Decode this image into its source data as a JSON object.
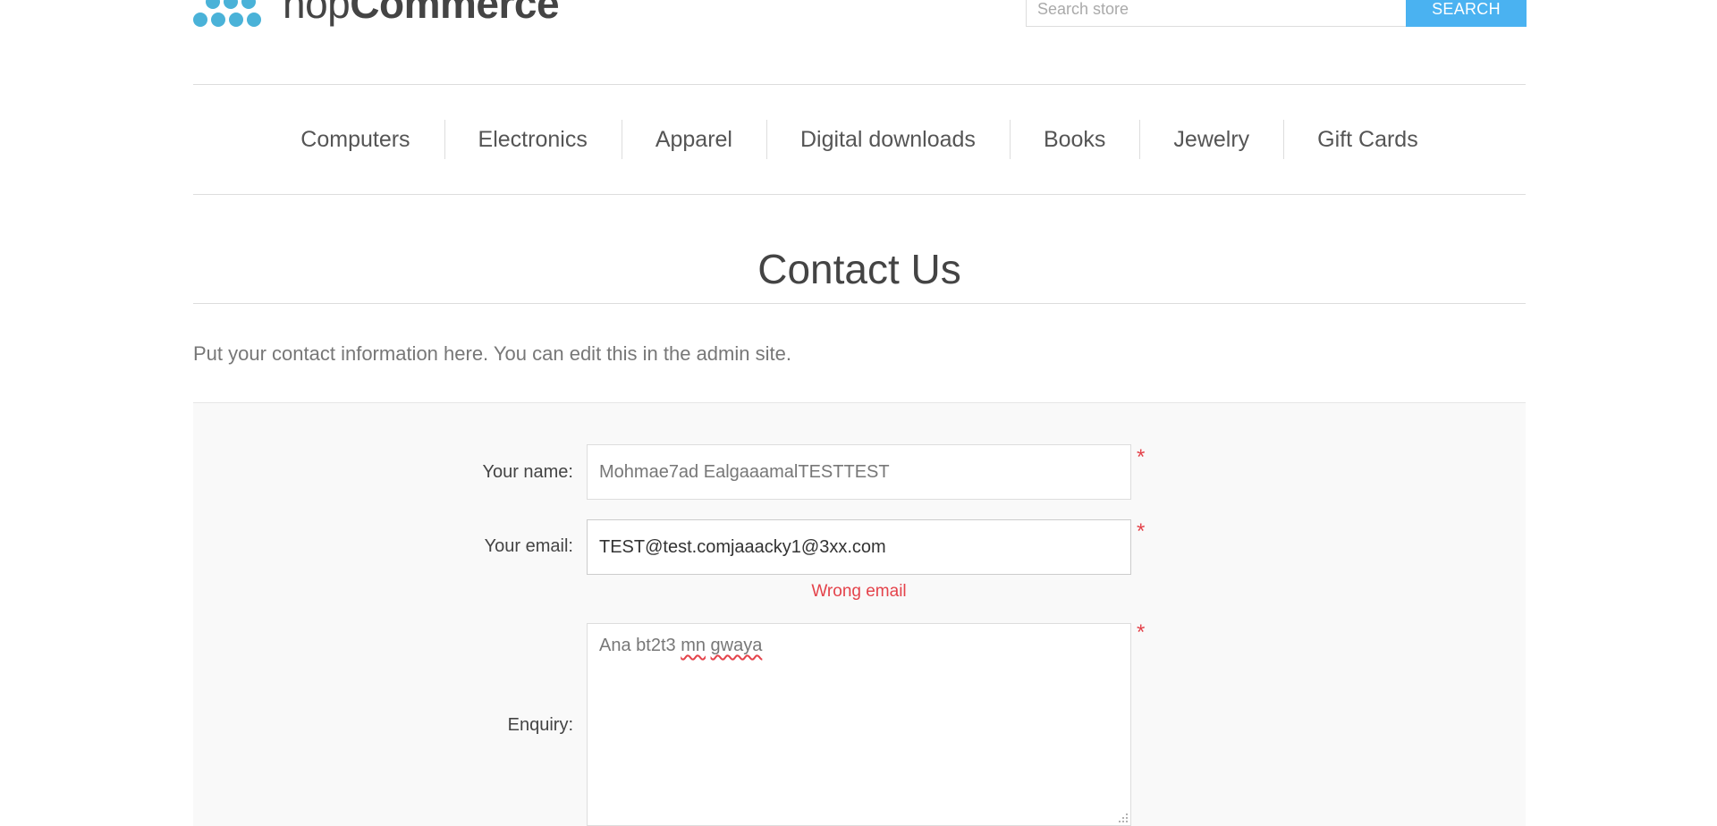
{
  "header": {
    "logo": {
      "light": "nop",
      "bold": "Commerce"
    },
    "search": {
      "placeholder": "Search store",
      "button_label": "SEARCH"
    },
    "colors": {
      "logo_dots": "#4ab2d8",
      "search_button": "#4ab2f1"
    }
  },
  "nav": {
    "items": [
      {
        "label": "Computers"
      },
      {
        "label": "Electronics"
      },
      {
        "label": "Apparel"
      },
      {
        "label": "Digital downloads"
      },
      {
        "label": "Books"
      },
      {
        "label": "Jewelry"
      },
      {
        "label": "Gift Cards"
      }
    ]
  },
  "page": {
    "title": "Contact Us",
    "topic_text": "Put your contact information here. You can edit this in the admin site."
  },
  "form": {
    "name": {
      "label": "Your name:",
      "value": "Mohmae7ad EalgaaamalTESTTEST",
      "required_mark": "*"
    },
    "email": {
      "label": "Your email:",
      "value": "TEST@test.comjaaacky1@3xx.com",
      "required_mark": "*",
      "error": "Wrong email"
    },
    "enquiry": {
      "label": "Enquiry:",
      "value_parts": [
        "Ana bt2t3 ",
        "mn",
        " ",
        "gwaya"
      ],
      "required_mark": "*"
    },
    "colors": {
      "error": "#e4434b",
      "panel_bg": "#f9f9f9"
    }
  }
}
